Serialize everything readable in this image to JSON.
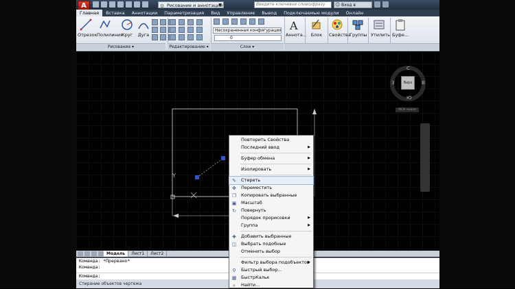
{
  "titlebar": {
    "logo_letter": "A",
    "workspace": "Рисование и аннотации",
    "search_placeholder": "Введите ключевое слово/фразу",
    "login": "Вход в службы"
  },
  "tabs": [
    "Главная",
    "Вставка",
    "Аннотации",
    "Параметризация",
    "Вид",
    "Управление",
    "Вывод",
    "Подключаемые модули",
    "Онлайн"
  ],
  "ribbon": {
    "draw_tools": [
      "Отрезок",
      "Полилиния",
      "Круг",
      "Дуга"
    ],
    "panels": {
      "draw": "Рисование ▾",
      "modify": "Редактирование ▾",
      "layers": "Слои ▾"
    },
    "layer_state": "Несохраненная конфигурация сло",
    "current_layer": "0",
    "right_tools": [
      "Аннота...",
      "Блок",
      "Свойства",
      "Группы",
      "Утилиты",
      "Буфе..."
    ]
  },
  "viewcube": {
    "north": "С",
    "south": "Ю",
    "west": "З",
    "east": "В",
    "face": "Верх",
    "ucs": "МСК новая"
  },
  "model_tabs": [
    "Модель",
    "Лист1",
    "Лист2"
  ],
  "command_line": {
    "line1": "Команда: *Прервано*",
    "line2": "Команда:",
    "line3": "Команда:"
  },
  "status_text": "Стирание объектов чертежа",
  "context_menu": [
    {
      "label": "Повторить Свойства"
    },
    {
      "label": "Последний ввод",
      "submenu": true
    },
    {
      "sep": true
    },
    {
      "label": "Буфер обмена",
      "submenu": true
    },
    {
      "sep": true
    },
    {
      "label": "Изолировать",
      "submenu": true
    },
    {
      "sep": true
    },
    {
      "label": "Стереть",
      "icon": "eraser-icon",
      "hover": true
    },
    {
      "label": "Переместить",
      "icon": "move-icon"
    },
    {
      "label": "Копировать выбранные",
      "icon": "copy-icon"
    },
    {
      "label": "Масштаб",
      "icon": "scale-icon"
    },
    {
      "label": "Повернуть",
      "icon": "rotate-icon"
    },
    {
      "label": "Порядок прорисовки",
      "submenu": true
    },
    {
      "label": "Группа",
      "submenu": true
    },
    {
      "sep": true
    },
    {
      "label": "Добавить выбранные",
      "icon": "add-selected-icon"
    },
    {
      "label": "Выбрать подобные",
      "icon": "select-similar-icon"
    },
    {
      "label": "Отменить выбор"
    },
    {
      "sep": true
    },
    {
      "label": "Фильтр выбора подобъектов",
      "submenu": true
    },
    {
      "label": "Быстрый выбор...",
      "icon": "quick-select-icon"
    },
    {
      "label": "БыстрКальк",
      "icon": "calculator-icon"
    },
    {
      "label": "Найти...",
      "icon": "find-icon"
    }
  ],
  "colors": {
    "canvas": "#000000",
    "ribbon": "#e3e8ee",
    "titlebar": "#2f3e50",
    "selection": "#3355cc"
  }
}
